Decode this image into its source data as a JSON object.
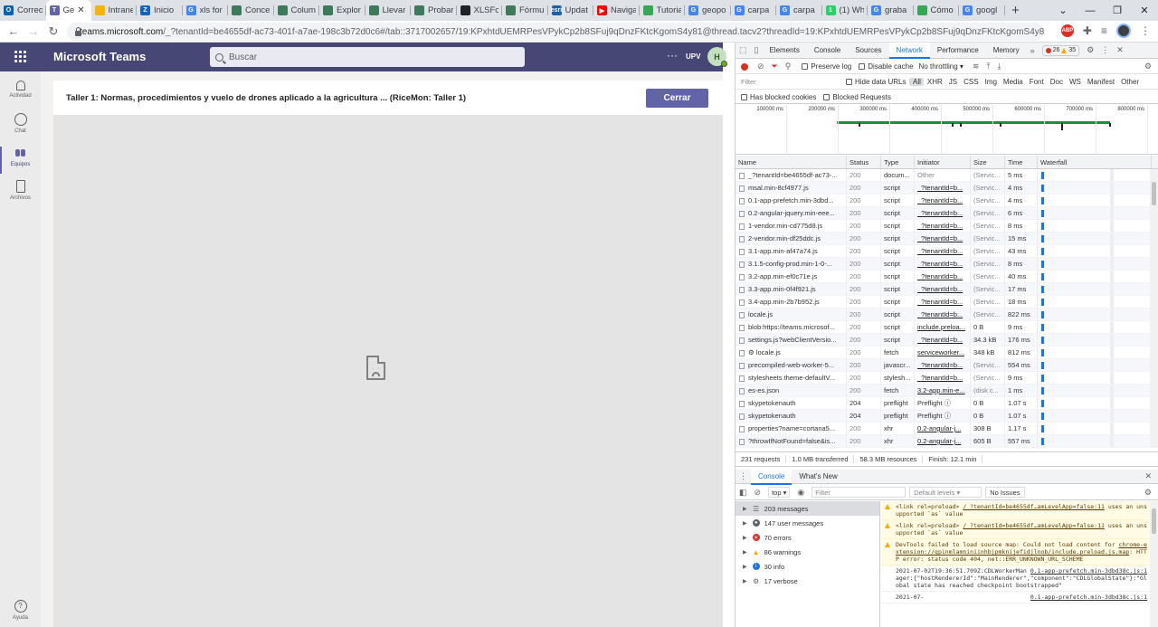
{
  "browser": {
    "tabs": [
      {
        "title": "Correo",
        "color": "#0364b8",
        "glyph": "O"
      },
      {
        "title": "Ge",
        "color": "#6264a7",
        "glyph": "T",
        "active": true
      },
      {
        "title": "Intranet",
        "color": "#f4b400",
        "glyph": ""
      },
      {
        "title": "Inicio",
        "color": "#1565c0",
        "glyph": "Z"
      },
      {
        "title": "xls for",
        "color": "#4285f4",
        "glyph": "G"
      },
      {
        "title": "Conce",
        "color": "#3c7a5a",
        "glyph": ""
      },
      {
        "title": "Colum",
        "color": "#3c7a5a",
        "glyph": ""
      },
      {
        "title": "Explor",
        "color": "#3c7a5a",
        "glyph": ""
      },
      {
        "title": "Llevar",
        "color": "#3c7a5a",
        "glyph": ""
      },
      {
        "title": "Probar",
        "color": "#3c7a5a",
        "glyph": ""
      },
      {
        "title": "XLSFor",
        "color": "#202124",
        "glyph": ""
      },
      {
        "title": "Fórmu",
        "color": "#3c7a5a",
        "glyph": ""
      },
      {
        "title": "Updat",
        "color": "#1b5fa8",
        "glyph": "esri"
      },
      {
        "title": "Naviga",
        "color": "#ff0000",
        "glyph": "▶"
      },
      {
        "title": "Tutoria",
        "color": "#34a853",
        "glyph": ""
      },
      {
        "title": "geopo",
        "color": "#4285f4",
        "glyph": "G"
      },
      {
        "title": "carpa",
        "color": "#4285f4",
        "glyph": "G"
      },
      {
        "title": "carpa",
        "color": "#4285f4",
        "glyph": "G"
      },
      {
        "title": "(1) Wh",
        "color": "#25d366",
        "glyph": "1"
      },
      {
        "title": "graba",
        "color": "#4285f4",
        "glyph": "G"
      },
      {
        "title": "Cómo",
        "color": "#34a853",
        "glyph": ""
      },
      {
        "title": "googl",
        "color": "#4285f4",
        "glyph": "G"
      }
    ],
    "url_host": "teams.microsoft.com",
    "url_path": "/_?tenantId=be4655df-ac73-401f-a7ae-198c3b72d0c6#/tab::3717002657/19:KPxhtdUEMRPesVPykCp2b8SFuj9qDnzFKtcKgomS4y81@thread.tacv2?threadId=19:KPxhtdUEMRPesVPykCp2b8SFuj9qDnzFKtcKgomS4y81@thread.tacv2&mess..."
  },
  "teams": {
    "app_title": "Microsoft Teams",
    "search_placeholder": "Buscar",
    "more": "···",
    "org": "UPV",
    "avatar_initial": "H",
    "rail": [
      {
        "label": "Actividad",
        "icon": "bell-icon"
      },
      {
        "label": "Chat",
        "icon": "chat-icon"
      },
      {
        "label": "Equipos",
        "icon": "teams-icon"
      },
      {
        "label": "Archivos",
        "icon": "files-icon"
      }
    ],
    "help_label": "Ayuda",
    "dialog_title": "Taller 1: Normas, procedimientos y vuelo de drones aplicado a la agricultura ... (RiceMon: Taller 1)",
    "close_label": "Cerrar"
  },
  "devtools": {
    "tabs": [
      "Elements",
      "Console",
      "Sources",
      "Network",
      "Performance",
      "Memory"
    ],
    "active_tab": "Network",
    "errors": "26",
    "warnings": "35",
    "preserve_log": "Preserve log",
    "disable_cache": "Disable cache",
    "throttling": "No throttling",
    "filter_placeholder": "Filter",
    "hide_data_urls": "Hide data URLs",
    "types": [
      "All",
      "XHR",
      "JS",
      "CSS",
      "Img",
      "Media",
      "Font",
      "Doc",
      "WS",
      "Manifest",
      "Other"
    ],
    "has_blocked_cookies": "Has blocked cookies",
    "blocked_requests": "Blocked Requests",
    "overview_ticks": [
      "100000 ms",
      "200000 ms",
      "300000 ms",
      "400000 ms",
      "500000 ms",
      "600000 ms",
      "700000 ms",
      "800000 ms"
    ],
    "columns": [
      "Name",
      "Status",
      "Type",
      "Initiator",
      "Size",
      "Time",
      "Waterfall"
    ],
    "requests": [
      {
        "name": "_?tenantId=be4655df-ac73-...",
        "status": "200",
        "type": "docum...",
        "initiator": "Other",
        "size": "(Servic...",
        "time": "5 ms"
      },
      {
        "name": "msal.min-8cf4977.js",
        "status": "200",
        "type": "script",
        "initiator": "_?tenantId=b...",
        "size": "(Servic...",
        "time": "4 ms"
      },
      {
        "name": "0.1-app-prefetch.min-3dbd...",
        "status": "200",
        "type": "script",
        "initiator": "_?tenantId=b...",
        "size": "(Servic...",
        "time": "4 ms"
      },
      {
        "name": "0.2-angular-jquery.min-eee...",
        "status": "200",
        "type": "script",
        "initiator": "_?tenantId=b...",
        "size": "(Servic...",
        "time": "6 ms"
      },
      {
        "name": "1-vendor.min-cd775d8.js",
        "status": "200",
        "type": "script",
        "initiator": "_?tenantId=b...",
        "size": "(Servic...",
        "time": "8 ms"
      },
      {
        "name": "2-vendor.min-df25ddc.js",
        "status": "200",
        "type": "script",
        "initiator": "_?tenantId=b...",
        "size": "(Servic...",
        "time": "15 ms"
      },
      {
        "name": "3.1-app.min-af47a74.js",
        "status": "200",
        "type": "script",
        "initiator": "_?tenantId=b...",
        "size": "(Servic...",
        "time": "43 ms"
      },
      {
        "name": "3.1.5-config-prod.min-1-0-...",
        "status": "200",
        "type": "script",
        "initiator": "_?tenantId=b...",
        "size": "(Servic...",
        "time": "8 ms"
      },
      {
        "name": "3.2-app.min-ef0c71e.js",
        "status": "200",
        "type": "script",
        "initiator": "_?tenantId=b...",
        "size": "(Servic...",
        "time": "40 ms"
      },
      {
        "name": "3.3-app.min-0f4f921.js",
        "status": "200",
        "type": "script",
        "initiator": "_?tenantId=b...",
        "size": "(Servic...",
        "time": "17 ms"
      },
      {
        "name": "3.4-app.min-2b7b952.js",
        "status": "200",
        "type": "script",
        "initiator": "_?tenantId=b...",
        "size": "(Servic...",
        "time": "18 ms"
      },
      {
        "name": "locale.js",
        "status": "200",
        "type": "script",
        "initiator": "_?tenantId=b...",
        "size": "(Servic...",
        "time": "822 ms"
      },
      {
        "name": "blob:https://teams.microsof...",
        "status": "200",
        "type": "script",
        "initiator": "include.preloa...",
        "size": "0 B",
        "time": "9 ms"
      },
      {
        "name": "settings.js?webClientVersio...",
        "status": "200",
        "type": "script",
        "initiator": "_?tenantId=b...",
        "size": "34.3 kB",
        "time": "176 ms"
      },
      {
        "name": "⚙ locale.js",
        "status": "200",
        "type": "fetch",
        "initiator": "serviceworker...",
        "size": "348 kB",
        "time": "812 ms"
      },
      {
        "name": "precompiled-web-worker-5...",
        "status": "200",
        "type": "javascr...",
        "initiator": "_?tenantId=b...",
        "size": "(Servic...",
        "time": "554 ms"
      },
      {
        "name": "stylesheets.theme-defaultV...",
        "status": "200",
        "type": "stylesh...",
        "initiator": "_?tenantId=b...",
        "size": "(Servic...",
        "time": "9 ms"
      },
      {
        "name": "es-es.json",
        "status": "200",
        "type": "fetch",
        "initiator": "3.2-app.min-e...",
        "size": "(disk c...",
        "time": "1 ms"
      },
      {
        "name": "skypetokenauth",
        "status": "204",
        "type": "preflight",
        "initiator": "Preflight ⓘ",
        "size": "0 B",
        "time": "1.07 s"
      },
      {
        "name": "skypetokenauth",
        "status": "204",
        "type": "preflight",
        "initiator": "Preflight ⓘ",
        "size": "0 B",
        "time": "1.07 s"
      },
      {
        "name": "properties?name=cortana5...",
        "status": "200",
        "type": "xhr",
        "initiator": "0.2-angular-j...",
        "size": "308 B",
        "time": "1.17 s"
      },
      {
        "name": "?throwIfNotFound=false&is...",
        "status": "200",
        "type": "xhr",
        "initiator": "0.2-angular-j...",
        "size": "605 B",
        "time": "557 ms"
      }
    ],
    "summary": {
      "requests": "231 requests",
      "transferred": "1.0 MB transferred",
      "resources": "58.3 MB resources",
      "finish": "Finish: 12.1 min"
    },
    "drawer_tabs": [
      "Console",
      "What's New"
    ],
    "console_context": "top",
    "console_filter_placeholder": "Filter",
    "default_levels": "Default levels ▾",
    "no_issues": "No Issues",
    "sidebar": [
      {
        "label": "203 messages",
        "icon": "list-icon",
        "color": "#5f6368"
      },
      {
        "label": "147 user messages",
        "icon": "user-icon",
        "color": "#5f6368"
      },
      {
        "label": "70 errors",
        "icon": "error-icon",
        "color": "#d93025"
      },
      {
        "label": "86 warnings",
        "icon": "warning-icon",
        "color": "#f9ab00"
      },
      {
        "label": "30 info",
        "icon": "info-icon",
        "color": "#1a73e8"
      },
      {
        "label": "17 verbose",
        "icon": "verbose-icon",
        "color": "#5f6368"
      }
    ],
    "log": [
      {
        "kind": "warn",
        "link": "/_?tenantId=be4655df…amLevelApp=false:11",
        "text": "<link rel=preload> ",
        "text2": " uses an unsupported `as` value"
      },
      {
        "kind": "warn",
        "link": "/_?tenantId=be4655df…amLevelApp=false:11",
        "text": "<link rel=preload> ",
        "text2": " uses an unsupported `as` value"
      },
      {
        "kind": "warn",
        "link": "chrome-extension://gpinmlamniniinhbjpmknijefidjlnob/include.preload.js.map",
        "text": "DevTools failed to load source map: Could not load content for ",
        "text2": ": HTTP error: status code 404, net::ERR_UNKNOWN_URL_SCHEME"
      },
      {
        "kind": "log",
        "src": "0.1-app-prefetch.min-3dbd38c.js:1",
        "text": "2021-07-02T19:36:51.709Z:CDLWorkerManager:{\"hostRendererId\":\"MainRenderer\",\"component\":\"CDLGlobalState\"}:\"Global state has reached checkpoint bootstrapped\""
      },
      {
        "kind": "log",
        "src": "0.1-app-prefetch.min-3dbd38c.js:1",
        "text": "2021-07-"
      }
    ]
  }
}
